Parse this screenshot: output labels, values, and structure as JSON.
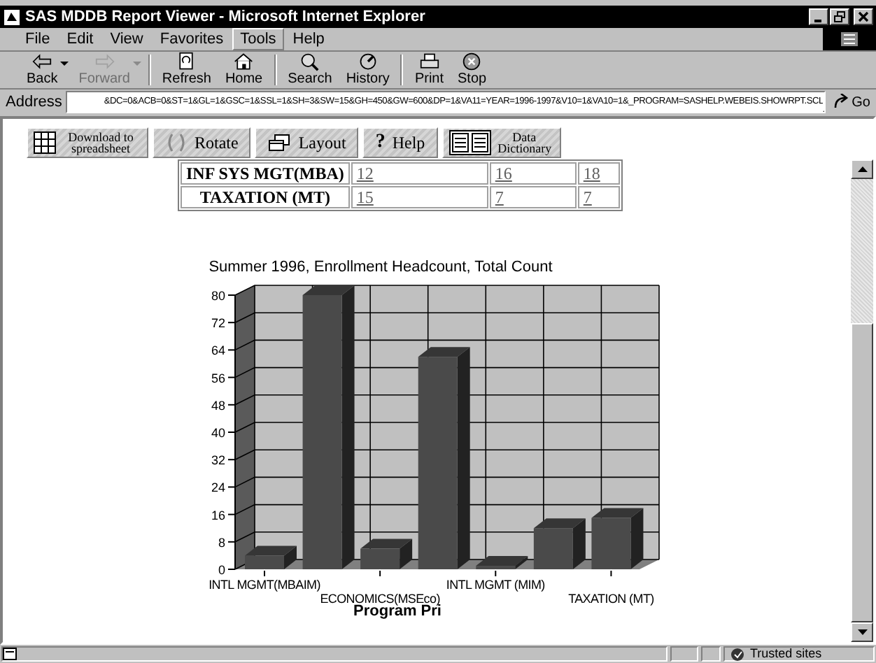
{
  "window": {
    "title": "SAS MDDB Report Viewer - Microsoft Internet Explorer"
  },
  "menu": [
    {
      "label": "File",
      "selected": false
    },
    {
      "label": "Edit",
      "selected": false
    },
    {
      "label": "View",
      "selected": false
    },
    {
      "label": "Favorites",
      "selected": false
    },
    {
      "label": "Tools",
      "selected": true
    },
    {
      "label": "Help",
      "selected": false
    }
  ],
  "toolbar": [
    {
      "kind": "back",
      "label": "Back",
      "disabled": false,
      "dropdown": true
    },
    {
      "kind": "forward",
      "label": "Forward",
      "disabled": true,
      "dropdown": true
    },
    {
      "kind": "refresh",
      "label": "Refresh",
      "disabled": false,
      "dropdown": false
    },
    {
      "kind": "home",
      "label": "Home",
      "disabled": false,
      "dropdown": false
    },
    {
      "kind": "search",
      "label": "Search",
      "disabled": false,
      "dropdown": false
    },
    {
      "kind": "history",
      "label": "History",
      "disabled": false,
      "dropdown": false
    },
    {
      "kind": "print",
      "label": "Print",
      "disabled": false,
      "dropdown": false
    },
    {
      "kind": "stop",
      "label": "Stop",
      "disabled": false,
      "dropdown": false
    }
  ],
  "address": {
    "label": "Address",
    "value": "&DC=0&ACB=0&ST=1&GL=1&GSC=1&SSL=1&SH=3&SW=15&GH=450&GW=600&DP=1&VA11=YEAR=1996-1997&V10=1&VA10=1&_PROGRAM=SASHELP.WEBEIS.SHOWRPT.SCL",
    "go": "Go"
  },
  "report_buttons": [
    {
      "kind": "spreadsheet",
      "label": "Download to spreadsheet"
    },
    {
      "kind": "rotate",
      "label": "Rotate"
    },
    {
      "kind": "layout",
      "label": "Layout"
    },
    {
      "kind": "help",
      "icon": "?",
      "label": "Help"
    },
    {
      "kind": "dictionary",
      "label": "Data Dictionary"
    }
  ],
  "table": {
    "rows": [
      {
        "label": "INF SYS MGT(MBA)",
        "values": [
          "12",
          "16",
          "18"
        ]
      },
      {
        "label": "TAXATION (MT)",
        "values": [
          "15",
          "7",
          "7"
        ]
      }
    ]
  },
  "chart": {
    "chart_data": {
      "type": "bar",
      "title": "Summer 1996, Enrollment Headcount, Total Count",
      "xlabel": "Program Pri",
      "categories": [
        "INTL MGMT(MBAIM)",
        null,
        "ECONOMICS(MSEco)",
        null,
        "INTL MGMT (MIM)",
        null,
        "TAXATION (MT)"
      ],
      "values": [
        4,
        80,
        6,
        62,
        1,
        12,
        15
      ],
      "ylim": [
        0,
        80
      ],
      "yticks": [
        0,
        8,
        16,
        24,
        32,
        40,
        48,
        56,
        64,
        72,
        80
      ]
    }
  },
  "status_bar": {
    "zone": "Trusted sites"
  }
}
